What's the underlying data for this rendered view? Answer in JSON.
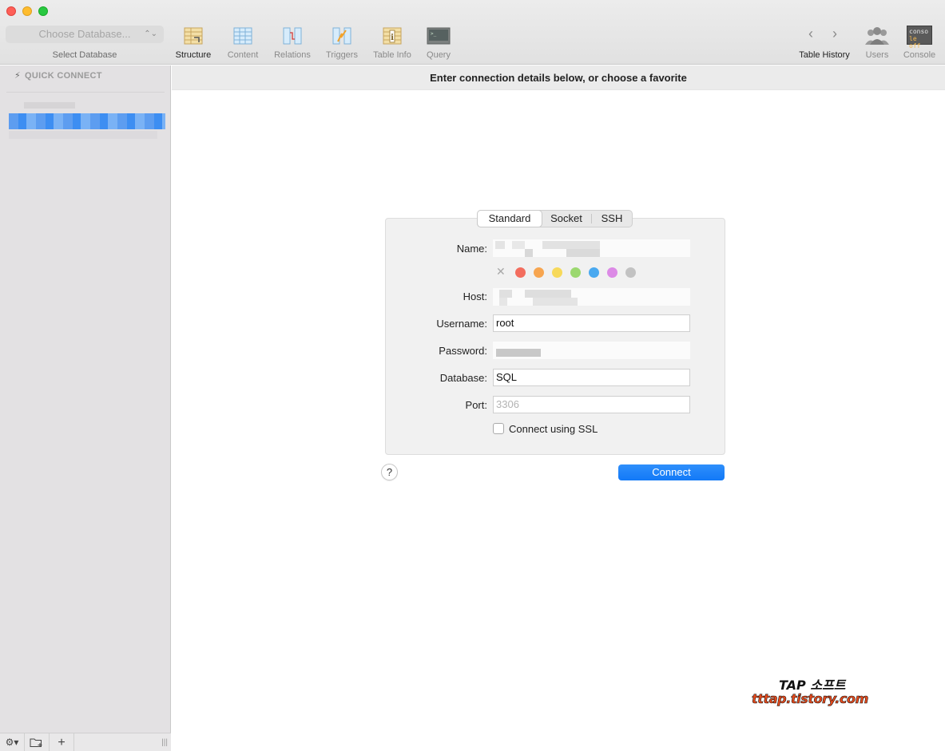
{
  "window": {
    "traffic_lights": [
      "close",
      "minimize",
      "zoom"
    ]
  },
  "toolbar": {
    "db_select_placeholder": "Choose Database...",
    "db_select_caption": "Select Database",
    "items": [
      {
        "label": "Structure",
        "icon": "structure-icon"
      },
      {
        "label": "Content",
        "icon": "content-icon"
      },
      {
        "label": "Relations",
        "icon": "relations-icon"
      },
      {
        "label": "Triggers",
        "icon": "triggers-icon"
      },
      {
        "label": "Table Info",
        "icon": "table-info-icon"
      },
      {
        "label": "Query",
        "icon": "query-icon"
      }
    ],
    "right": {
      "history_label": "Table History",
      "users_label": "Users",
      "console_label": "Console",
      "console_icon_text_top": "conso",
      "console_icon_text_bottom": "le off"
    }
  },
  "sidebar": {
    "quick_connect": "QUICK CONNECT",
    "bottom_buttons": [
      "gear",
      "new-folder",
      "add"
    ]
  },
  "main": {
    "header": "Enter connection details below, or choose a favorite",
    "tabs": [
      "Standard",
      "Socket",
      "SSH"
    ],
    "active_tab": "Standard",
    "fields": {
      "name_label": "Name:",
      "host_label": "Host:",
      "username_label": "Username:",
      "username_value": "root",
      "password_label": "Password:",
      "database_label": "Database:",
      "database_value": "SQL",
      "port_label": "Port:",
      "port_placeholder": "3306"
    },
    "color_tags": [
      "#f36d5e",
      "#f7a54f",
      "#f7d95a",
      "#9bd86f",
      "#4aa9f0",
      "#dc8ae6",
      "#c2c2c2"
    ],
    "ssl_label": "Connect using SSL",
    "help": "?",
    "connect": "Connect"
  },
  "watermark": {
    "line1": "TAP 소프트",
    "line2": "tttap.tistory.com"
  },
  "colors": {
    "accent": "#1279f7",
    "sidebar_bg": "#e3e1e3"
  }
}
